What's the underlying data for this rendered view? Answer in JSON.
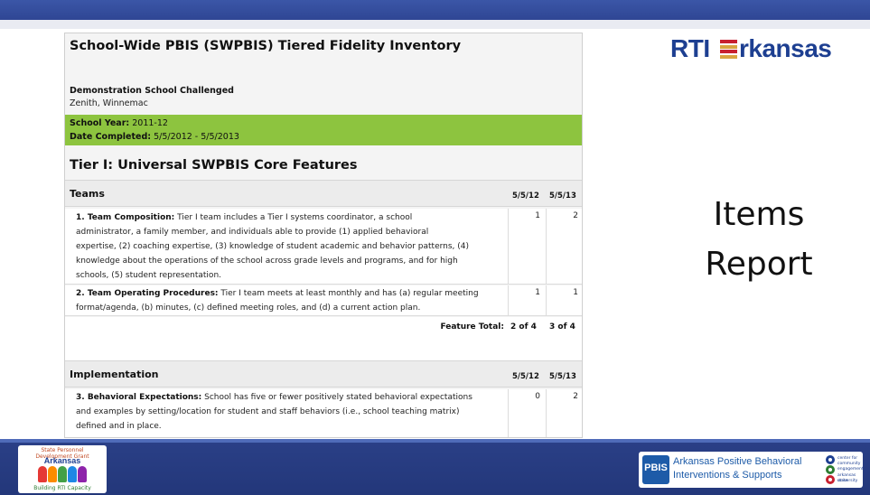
{
  "report": {
    "title": "School-Wide PBIS (SWPBIS) Tiered Fidelity Inventory",
    "school_name": "Demonstration School Challenged",
    "school_location": "Zenith, Winnemac",
    "school_year_label": "School Year:",
    "school_year": "2011-12",
    "date_completed_label": "Date Completed:",
    "date_completed": "5/5/2012 - 5/5/2013",
    "tier_title": "Tier I: Universal SWPBIS Core Features"
  },
  "sections": [
    {
      "name": "Teams",
      "dates": [
        "5/5/12",
        "5/5/13"
      ],
      "items": [
        {
          "label": "1. Team Composition:",
          "lines": [
            " Tier I team includes a Tier I systems coordinator, a school",
            "administrator, a family member, and individuals able to provide (1) applied behavioral",
            "expertise, (2) coaching expertise, (3) knowledge of student academic and behavior patterns, (4)",
            "knowledge about the operations of the school across grade levels and programs, and for high",
            "schools, (5) student representation."
          ],
          "scores": [
            "1",
            "2"
          ]
        },
        {
          "label": "2. Team Operating Procedures:",
          "lines": [
            " Tier I team meets at least monthly and has (a) regular meeting",
            "format/agenda, (b) minutes, (c) defined meeting roles, and (d) a current action plan."
          ],
          "scores": [
            "1",
            "1"
          ]
        }
      ],
      "total_label": "Feature Total:",
      "totals": [
        "2 of 4",
        "3 of 4"
      ]
    },
    {
      "name": "Implementation",
      "dates": [
        "5/5/12",
        "5/5/13"
      ],
      "items": [
        {
          "label": "3. Behavioral Expectations:",
          "lines": [
            " School has five or fewer positively stated behavioral expectations",
            "and examples by setting/location for student and staff behaviors (i.e., school teaching matrix)",
            "defined and in place."
          ],
          "scores": [
            "0",
            "2"
          ]
        }
      ]
    }
  ],
  "brand": {
    "left": "RTI",
    "right": "rkansas"
  },
  "headline": {
    "line1": "Items",
    "line2": "Report"
  },
  "footer": {
    "left_logo": {
      "arc": "State Personnel Development Grant",
      "name": "Arkansas",
      "tag": "Building RTI Capacity"
    },
    "right_logo": {
      "mark": "PBIS",
      "line1": "Arkansas Positive Behavioral",
      "line2": "Interventions & Supports",
      "center_text": [
        "center for",
        "community",
        "engagement",
        "arkansas state",
        "university"
      ]
    }
  },
  "colors": {
    "bar_blue": "#2f4694",
    "fidelity_green": "#8dc43f",
    "brand_blue": "#1d3f91",
    "brand_red": "#c8202f"
  }
}
